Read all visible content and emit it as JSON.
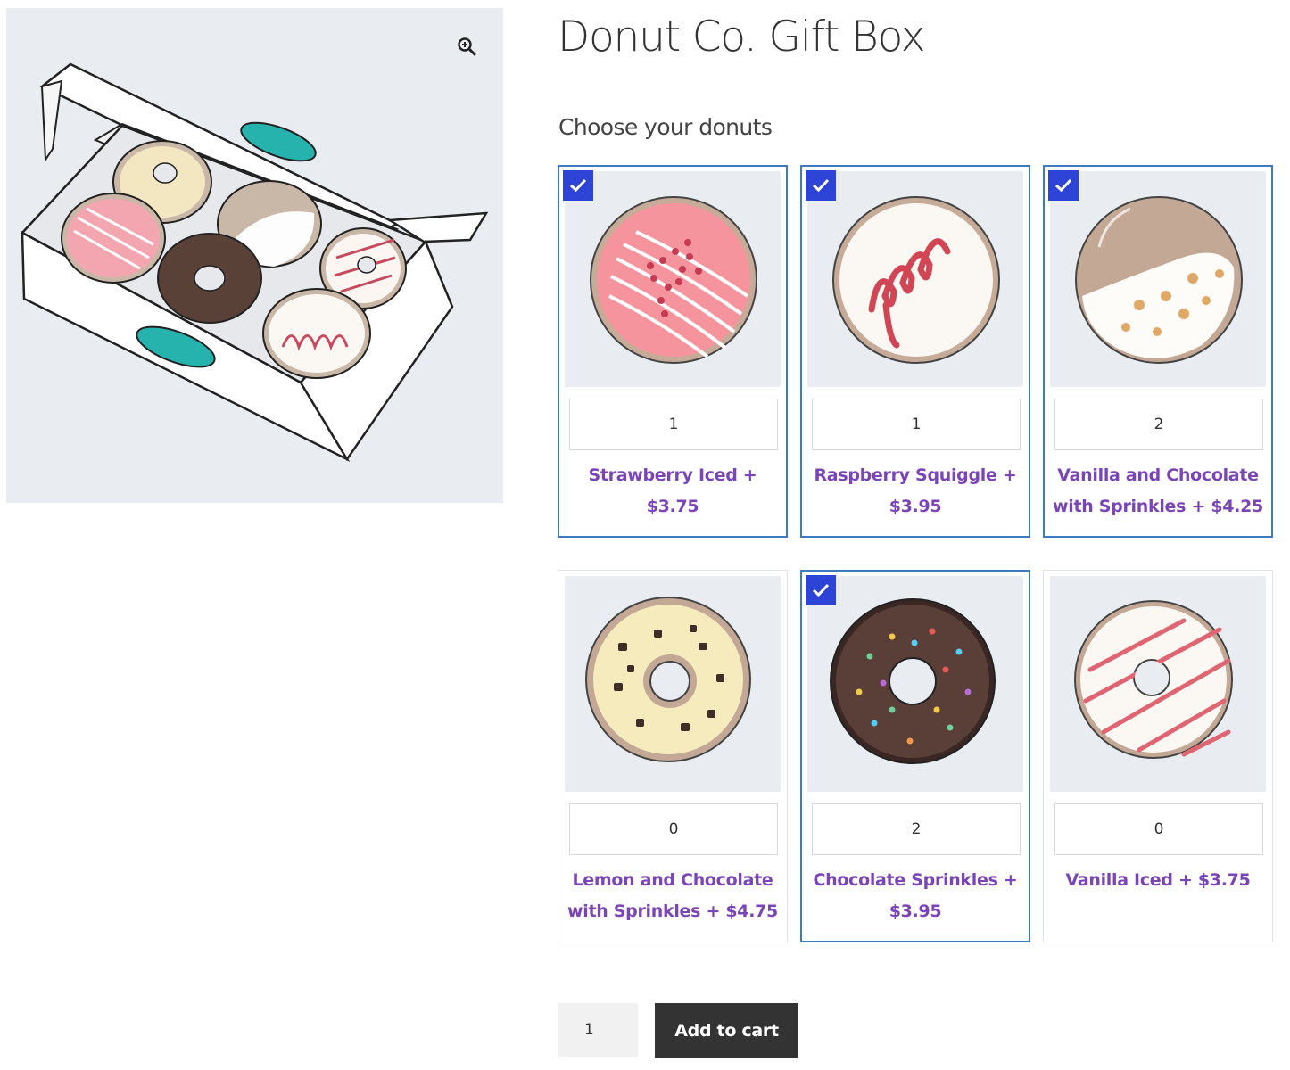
{
  "product": {
    "title": "Donut Co. Gift Box"
  },
  "chooser": {
    "label": "Choose your donuts"
  },
  "donuts": [
    {
      "name": "Strawberry Iced + $3.75",
      "quantity": "1",
      "selected": true
    },
    {
      "name": "Raspberry Squiggle + $3.95",
      "quantity": "1",
      "selected": true
    },
    {
      "name": "Vanilla and Chocolate with Sprinkles + $4.25",
      "quantity": "2",
      "selected": true
    },
    {
      "name": "Lemon and Chocolate with Sprinkles + $4.75",
      "quantity": "0",
      "selected": false
    },
    {
      "name": "Chocolate Sprinkles + $3.95",
      "quantity": "2",
      "selected": true
    },
    {
      "name": "Vanilla Iced + $3.75",
      "quantity": "0",
      "selected": false
    }
  ],
  "cart": {
    "quantity": "1",
    "button_label": "Add to cart"
  },
  "colors": {
    "accent": "#7a45b7",
    "selected_border": "#3b7bbf",
    "check_bg": "#2d44d6",
    "button_bg": "#333333"
  }
}
